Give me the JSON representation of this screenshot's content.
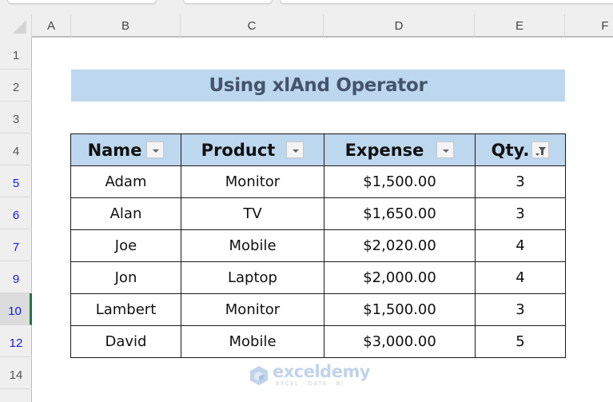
{
  "spreadsheet": {
    "columns": [
      "A",
      "B",
      "C",
      "D",
      "E",
      "F"
    ],
    "rows": [
      {
        "label": "1",
        "state": "normal"
      },
      {
        "label": "2",
        "state": "normal"
      },
      {
        "label": "3",
        "state": "normal"
      },
      {
        "label": "4",
        "state": "normal"
      },
      {
        "label": "5",
        "state": "filtered"
      },
      {
        "label": "6",
        "state": "filtered"
      },
      {
        "label": "7",
        "state": "filtered"
      },
      {
        "label": "9",
        "state": "filtered"
      },
      {
        "label": "10",
        "state": "selected"
      },
      {
        "label": "12",
        "state": "filtered"
      },
      {
        "label": "14",
        "state": "normal"
      }
    ],
    "selected_row": "10"
  },
  "title": "Using xlAnd Operator",
  "table": {
    "headers": [
      {
        "label": "Name",
        "filter": "dropdown"
      },
      {
        "label": "Product",
        "filter": "dropdown"
      },
      {
        "label": "Expense",
        "filter": "dropdown"
      },
      {
        "label": "Qty.",
        "filter": "filter-applied"
      }
    ],
    "rows": [
      [
        "Adam",
        "Monitor",
        "$1,500.00",
        "3"
      ],
      [
        "Alan",
        "TV",
        "$1,650.00",
        "3"
      ],
      [
        "Joe",
        "Mobile",
        "$2,020.00",
        "4"
      ],
      [
        "Jon",
        "Laptop",
        "$2,000.00",
        "4"
      ],
      [
        "Lambert",
        "Monitor",
        "$1,500.00",
        "3"
      ],
      [
        "David",
        "Mobile",
        "$3,000.00",
        "5"
      ]
    ]
  },
  "watermark": {
    "main": "exceldemy",
    "sub": "EXCEL · DATA · BI"
  },
  "colors": {
    "title_band": "#bdd7ee",
    "title_text": "#44546a",
    "header_fill": "#bdd7ee",
    "filtered_row_number": "#1a1adb",
    "selection_accent": "#217346"
  }
}
